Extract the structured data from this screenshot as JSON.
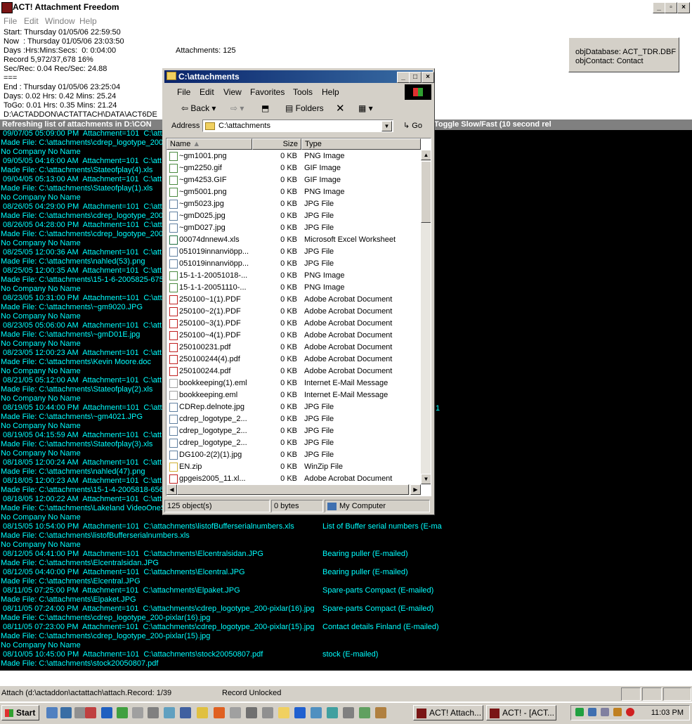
{
  "app": {
    "title": "ACT! Attachment Freedom"
  },
  "menu": [
    "File",
    "Edit",
    "Window",
    "Help"
  ],
  "status": {
    "start": "Start: Thursday 01/05/06 22:59:50",
    "now": "Now  : Thursday 01/05/06 23:03:50",
    "days": "Days :Hrs:Mins:Secs:  0: 0:04:00",
    "record": "Record 5,972/37,678 16%",
    "sec_rec": "Sec/Rec: 0.04 Rec/Sec: 24.88",
    "sep": "===",
    "end": "End : Thursday 01/05/06 23:25:04",
    "days_hrs": "Days: 0.02 Hrs: 0.42 Mins: 25.24",
    "togo": "ToGo: 0.01 Hrs: 0.35 Mins: 21.24",
    "path": "D:\\ACTADDON\\ACTATTACH\\DATA\\ACT6DE",
    "attachments": "Attachments: 125"
  },
  "obj_panel": {
    "database": "objDatabase: ACT_TDR.DBF",
    "contact": "objContact: Contact"
  },
  "console": {
    "header_left": "Refreshing list of attachments in D:\\CON",
    "header_right": "Toggle Slow/Fast (10 second rel",
    "left_lines": [
      " 09/07/05 05:09:00 PM  Attachment=101  C:\\att",
      "Made File: C:\\attachments\\cdrep_logotype_200-",
      "No Company No Name",
      " 09/05/05 04:16:00 AM  Attachment=101  C:\\att",
      "Made File: C:\\attachments\\Stateofplay(4).xls",
      " 09/04/05 05:13:00 AM  Attachment=101  C:\\att",
      "Made File: C:\\attachments\\Stateofplay(1).xls",
      "No Company No Name",
      " 08/26/05 04:29:00 PM  Attachment=101  C:\\att",
      "Made File: C:\\attachments\\cdrep_logotype_200-",
      " 08/26/05 04:28:00 PM  Attachment=101  C:\\att",
      "Made File: C:\\attachments\\cdrep_logotype_200-",
      "No Company No Name",
      " 08/25/05 12:00:36 AM  Attachment=101  C:\\att",
      "Made File: C:\\attachments\\nahled(53).png",
      " 08/25/05 12:00:35 AM  Attachment=101  C:\\att",
      "Made File: C:\\attachments\\15-1-6-2005825-675.",
      "No Company No Name",
      " 08/23/05 10:31:00 PM  Attachment=101  C:\\att",
      "Made File: C:\\attachments\\~gm9020.JPG",
      "No Company No Name",
      " 08/23/05 05:06:00 AM  Attachment=101  C:\\att",
      "Made File: C:\\attachments\\~gmD01E.jpg",
      "No Company No Name",
      " 08/23/05 12:00:23 AM  Attachment=101  C:\\att",
      "Made File: C:\\attachments\\Kevin Moore.doc",
      "No Company No Name",
      " 08/21/05 05:12:00 AM  Attachment=101  C:\\att",
      "Made File: C:\\attachments\\Stateofplay(2).xls",
      "No Company No Name",
      " 08/19/05 10:44:00 PM  Attachment=101  C:\\att",
      "Made File: C:\\attachments\\~gm4021.JPG",
      "No Company No Name",
      " 08/19/05 04:15:59 AM  Attachment=101  C:\\att",
      "Made File: C:\\attachments\\Stateofplay(3).xls",
      "No Company No Name",
      " 08/18/05 12:00:24 AM  Attachment=101  C:\\att",
      "Made File: C:\\attachments\\nahled(47).png",
      " 08/18/05 12:00:23 AM  Attachment=101  C:\\att",
      "Made File: C:\\attachments\\15-1-4-2005818-656",
      " 08/18/05 12:00:22 AM  Attachment=101  C:\\att",
      "Made File: C:\\attachments\\Lakeland VideoOneS",
      "No Company No Name",
      " 08/15/05 10:54:00 PM  Attachment=101  C:\\attachments\\listofBufferserialnumbers.xls",
      "Made File: C:\\attachments\\listofBufferserialnumbers.xls",
      "No Company No Name",
      " 08/12/05 04:41:00 PM  Attachment=101  C:\\attachments\\Elcentralsidan.JPG",
      "Made File: C:\\attachments\\Elcentralsidan.JPG",
      " 08/12/05 04:40:00 PM  Attachment=101  C:\\attachments\\Elcentral.JPG",
      "Made File: C:\\attachments\\Elcentral.JPG",
      " 08/11/05 07:25:00 PM  Attachment=101  C:\\attachments\\Elpaket.JPG",
      "Made File: C:\\attachments\\Elpaket.JPG",
      " 08/11/05 07:24:00 PM  Attachment=101  C:\\attachments\\cdrep_logotype_200-pixlar(16).jpg",
      "Made File: C:\\attachments\\cdrep_logotype_200-pixlar(16).jpg",
      " 08/11/05 07:23:00 PM  Attachment=101  C:\\attachments\\cdrep_logotype_200-pixlar(15).jpg",
      "Made File: C:\\attachments\\cdrep_logotype_200-pixlar(15).jpg",
      "No Company No Name",
      " 08/10/05 10:45:00 PM  Attachment=101  C:\\attachments\\stock20050807.pdf",
      "Made File: C:\\attachments\\stock20050807.pdf"
    ],
    "right_notes": [
      {
        "row": 43,
        "text": "List of Buffer serial numbers (E-ma"
      },
      {
        "row": 46,
        "text": "Bearing puller (E-mailed)"
      },
      {
        "row": 48,
        "text": "Bearing puller (E-mailed)"
      },
      {
        "row": 50,
        "text": "Spare-parts Compact (E-mailed)"
      },
      {
        "row": 52,
        "text": "Spare-parts Compact (E-mailed)"
      },
      {
        "row": 54,
        "text": "Contact details Finland (E-mailed)"
      },
      {
        "row": 57,
        "text": "stock (E-mailed)"
      }
    ],
    "stray_char": "1"
  },
  "statusbar": {
    "left": "Attach (d:\\actaddon\\actattach\\attach.Record: 1/39",
    "mid": "Record Unlocked"
  },
  "taskbar": {
    "start": "Start",
    "tasks": [
      "ACT! Attach...",
      "ACT! - [ACT..."
    ],
    "clock": "11:03 PM"
  },
  "explorer": {
    "title": "C:\\attachments",
    "menu": [
      "File",
      "Edit",
      "View",
      "Favorites",
      "Tools",
      "Help"
    ],
    "toolbar": {
      "back": "Back",
      "folders": "Folders"
    },
    "address_label": "Address",
    "address": "C:\\attachments",
    "go": "Go",
    "columns": [
      "Name",
      "Size",
      "Type"
    ],
    "files": [
      {
        "name": "~gm1001.png",
        "size": "0 KB",
        "type": "PNG Image",
        "icon": "image"
      },
      {
        "name": "~gm2250.gif",
        "size": "0 KB",
        "type": "GIF Image",
        "icon": "image"
      },
      {
        "name": "~gm4253.GIF",
        "size": "0 KB",
        "type": "GIF Image",
        "icon": "image"
      },
      {
        "name": "~gm5001.png",
        "size": "0 KB",
        "type": "PNG Image",
        "icon": "image"
      },
      {
        "name": "~gm5023.jpg",
        "size": "0 KB",
        "type": "JPG File",
        "icon": "jpg"
      },
      {
        "name": "~gmD025.jpg",
        "size": "0 KB",
        "type": "JPG File",
        "icon": "jpg"
      },
      {
        "name": "~gmD027.jpg",
        "size": "0 KB",
        "type": "JPG File",
        "icon": "jpg"
      },
      {
        "name": "00074dnnew4.xls",
        "size": "0 KB",
        "type": "Microsoft Excel Worksheet",
        "icon": "excel"
      },
      {
        "name": "051019innanviöpp...",
        "size": "0 KB",
        "type": "JPG File",
        "icon": "jpg"
      },
      {
        "name": "051019innanviöpp...",
        "size": "0 KB",
        "type": "JPG File",
        "icon": "jpg"
      },
      {
        "name": "15-1-1-20051018-...",
        "size": "0 KB",
        "type": "PNG Image",
        "icon": "image"
      },
      {
        "name": "15-1-1-20051110-...",
        "size": "0 KB",
        "type": "PNG Image",
        "icon": "image"
      },
      {
        "name": "250100~1(1).PDF",
        "size": "0 KB",
        "type": "Adobe Acrobat Document",
        "icon": "pdf"
      },
      {
        "name": "250100~2(1).PDF",
        "size": "0 KB",
        "type": "Adobe Acrobat Document",
        "icon": "pdf"
      },
      {
        "name": "250100~3(1).PDF",
        "size": "0 KB",
        "type": "Adobe Acrobat Document",
        "icon": "pdf"
      },
      {
        "name": "250100~4(1).PDF",
        "size": "0 KB",
        "type": "Adobe Acrobat Document",
        "icon": "pdf"
      },
      {
        "name": "250100231.pdf",
        "size": "0 KB",
        "type": "Adobe Acrobat Document",
        "icon": "pdf"
      },
      {
        "name": "250100244(4).pdf",
        "size": "0 KB",
        "type": "Adobe Acrobat Document",
        "icon": "pdf"
      },
      {
        "name": "250100244.pdf",
        "size": "0 KB",
        "type": "Adobe Acrobat Document",
        "icon": "pdf"
      },
      {
        "name": "bookkeeping(1).eml",
        "size": "0 KB",
        "type": "Internet E-Mail Message",
        "icon": "email"
      },
      {
        "name": "bookkeeping.eml",
        "size": "0 KB",
        "type": "Internet E-Mail Message",
        "icon": "email"
      },
      {
        "name": "CDRep.delnote.jpg",
        "size": "0 KB",
        "type": "JPG File",
        "icon": "jpg"
      },
      {
        "name": "cdrep_logotype_2...",
        "size": "0 KB",
        "type": "JPG File",
        "icon": "jpg"
      },
      {
        "name": "cdrep_logotype_2...",
        "size": "0 KB",
        "type": "JPG File",
        "icon": "jpg"
      },
      {
        "name": "cdrep_logotype_2...",
        "size": "0 KB",
        "type": "JPG File",
        "icon": "jpg"
      },
      {
        "name": "DG100-2(2)(1).jpg",
        "size": "0 KB",
        "type": "JPG File",
        "icon": "jpg"
      },
      {
        "name": "EN.zip",
        "size": "0 KB",
        "type": "WinZip File",
        "icon": "zip"
      },
      {
        "name": "gpgeis2005_11.xl...",
        "size": "0 KB",
        "type": "Adobe Acrobat Document",
        "icon": "pdf"
      }
    ],
    "status": {
      "objects": "125 object(s)",
      "bytes": "0 bytes",
      "location": "My Computer"
    }
  },
  "colors": {
    "console_text": "#00ffff",
    "console_bg": "#000000",
    "title_active": "#0a246a",
    "chrome": "#d4d0c8"
  }
}
